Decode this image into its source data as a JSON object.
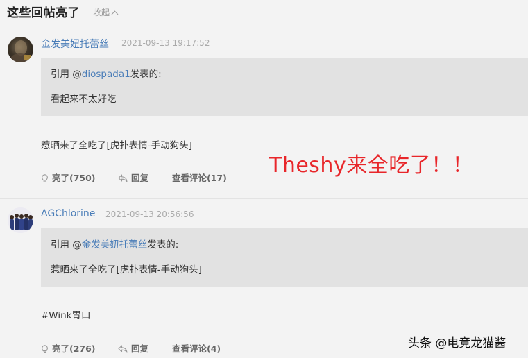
{
  "section": {
    "title": "这些回帖亮了",
    "collapse_label": "收起"
  },
  "posts": [
    {
      "username": "金发美妞托蕾丝",
      "timestamp": "2021-09-13 19:17:52",
      "quote": {
        "prefix": "引用 @",
        "mention": "diospada1",
        "suffix": "发表的:",
        "text": "看起来不太好吃"
      },
      "body": "惹晒来了全吃了[虎扑表情-手动狗头]",
      "actions": {
        "like": "亮了(750)",
        "reply": "回复",
        "comments": "查看评论(17)"
      }
    },
    {
      "username": "AGChlorine",
      "timestamp": "2021-09-13 20:56:56",
      "quote": {
        "prefix": "引用 @",
        "mention": "金发美妞托蕾丝",
        "suffix": "发表的:",
        "text": "惹晒来了全吃了[虎扑表情-手动狗头]"
      },
      "body": "#Wink胃口",
      "actions": {
        "like": "亮了(276)",
        "reply": "回复",
        "comments": "查看评论(4)"
      }
    }
  ],
  "overlay_caption": "Theshy来全吃了！！",
  "watermark": "头条 @电竞龙猫酱",
  "colors": {
    "link": "#4a7db8",
    "overlay": "#e8262a",
    "quote_bg": "#e2e2e2",
    "page_bg": "#f3f3f3"
  },
  "icons": {
    "like": "lightbulb-icon",
    "reply": "reply-arrow-icon",
    "collapse": "chevron-up-icon"
  }
}
